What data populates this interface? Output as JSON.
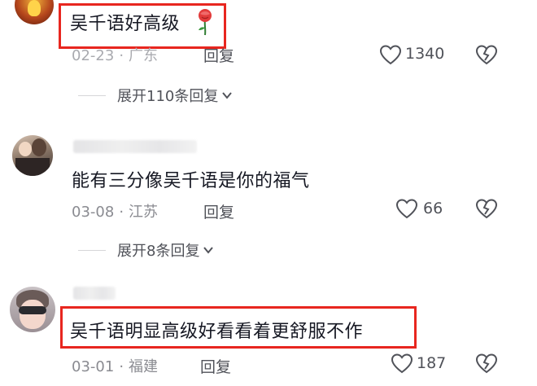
{
  "comments": [
    {
      "text": "吴千语好高级",
      "date": "02-23",
      "location": "广东",
      "reply_label": "回复",
      "likes": "1340",
      "icons": {
        "emoji": "rose-icon",
        "like": "heart-outline-icon",
        "dislike": "broken-heart-icon"
      }
    },
    {
      "text": "能有三分像吴千语是你的福气",
      "date": "03-08",
      "location": "江苏",
      "reply_label": "回复",
      "likes": "66",
      "icons": {
        "like": "heart-outline-icon",
        "dislike": "broken-heart-icon"
      }
    },
    {
      "text": "吴千语明显高级好看看着更舒服不作",
      "date": "03-01",
      "location": "福建",
      "reply_label": "回复",
      "likes": "187",
      "icons": {
        "like": "heart-outline-icon",
        "dislike": "broken-heart-icon"
      }
    }
  ],
  "expanders": [
    {
      "label": "展开110条回复"
    },
    {
      "label": "展开8条回复"
    }
  ],
  "colors": {
    "highlight": "#e8261f",
    "meta_text": "#8a8b91",
    "body_text": "#161823"
  }
}
